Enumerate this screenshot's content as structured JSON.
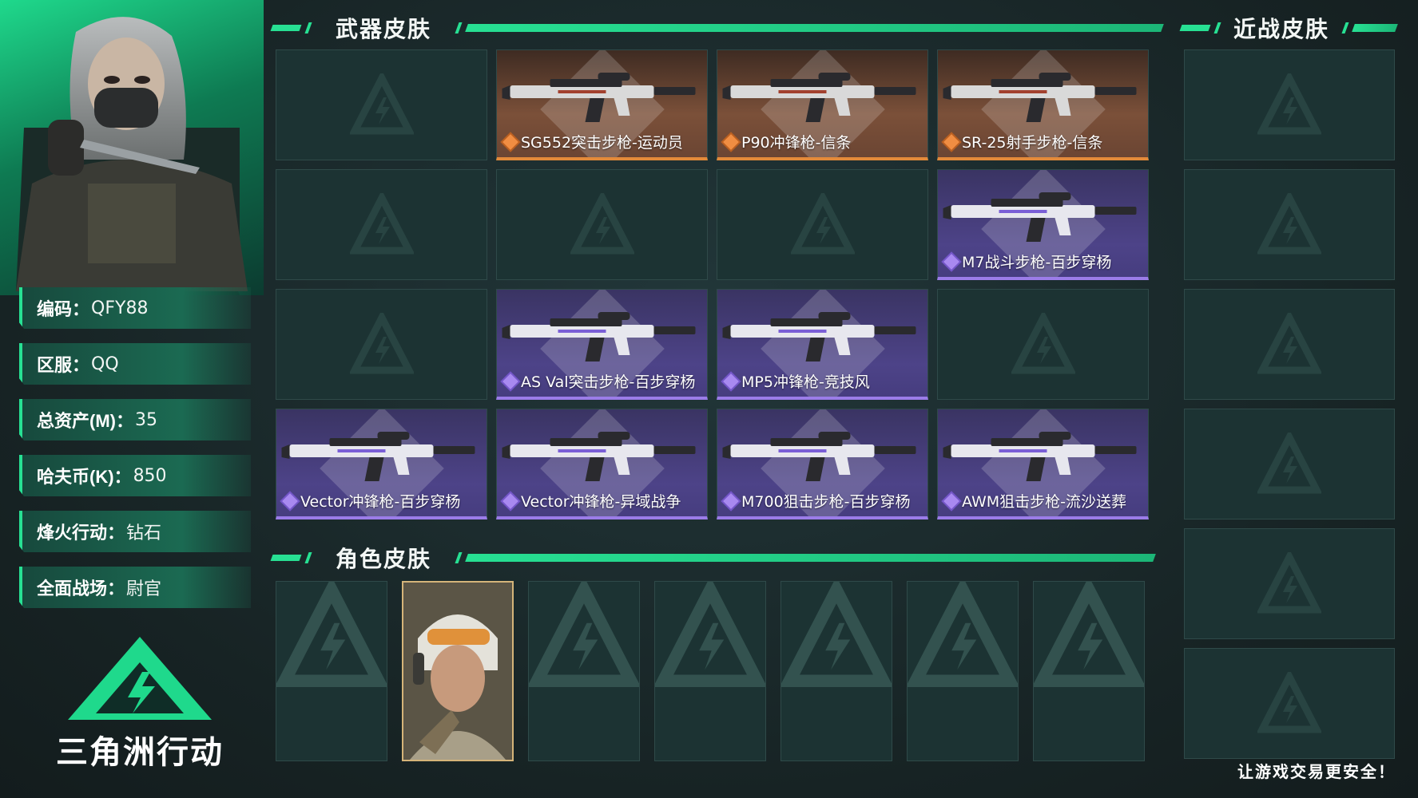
{
  "profile": {
    "rows": [
      {
        "key": "编码",
        "sep": "：",
        "value": "QFY88"
      },
      {
        "key": "区服",
        "sep": "：",
        "value": "QQ"
      },
      {
        "key": "总资产(M)",
        "sep": "：",
        "value": "35"
      },
      {
        "key": "哈夫币(K)",
        "sep": "：",
        "value": "850"
      },
      {
        "key": "烽火行动",
        "sep": "：",
        "value": "钻石"
      },
      {
        "key": "全面战场",
        "sep": "：",
        "value": "尉官"
      }
    ],
    "logo_text": "三角洲行动"
  },
  "weapon_section": {
    "title": "武器皮肤",
    "cards": [
      {
        "label": "",
        "rarity": "empty"
      },
      {
        "label": "SG552突击步枪-运动员",
        "rarity": "gold"
      },
      {
        "label": "P90冲锋枪-信条",
        "rarity": "gold"
      },
      {
        "label": "SR-25射手步枪-信条",
        "rarity": "gold"
      },
      {
        "label": "",
        "rarity": "empty"
      },
      {
        "label": "",
        "rarity": "empty"
      },
      {
        "label": "",
        "rarity": "empty"
      },
      {
        "label": "M7战斗步枪-百步穿杨",
        "rarity": "purple"
      },
      {
        "label": "",
        "rarity": "empty"
      },
      {
        "label": "AS Val突击步枪-百步穿杨",
        "rarity": "purple"
      },
      {
        "label": "MP5冲锋枪-竞技风",
        "rarity": "purple"
      },
      {
        "label": "",
        "rarity": "empty"
      },
      {
        "label": "Vector冲锋枪-百步穿杨",
        "rarity": "purple"
      },
      {
        "label": "Vector冲锋枪-异域战争",
        "rarity": "purple"
      },
      {
        "label": "M700狙击步枪-百步穿杨",
        "rarity": "purple"
      },
      {
        "label": "AWM狙击步枪-流沙送葬",
        "rarity": "purple"
      }
    ]
  },
  "character_section": {
    "title": "角色皮肤",
    "slots": [
      false,
      true,
      false,
      false,
      false,
      false,
      false
    ]
  },
  "melee_section": {
    "title": "近战皮肤",
    "slots": 6
  },
  "footer": "让游戏交易更安全！",
  "colors": {
    "accent": "#27e093",
    "gold_border": "#e38a3a",
    "purple_border": "#9b7ce8",
    "card_bg": "#1c3333"
  }
}
